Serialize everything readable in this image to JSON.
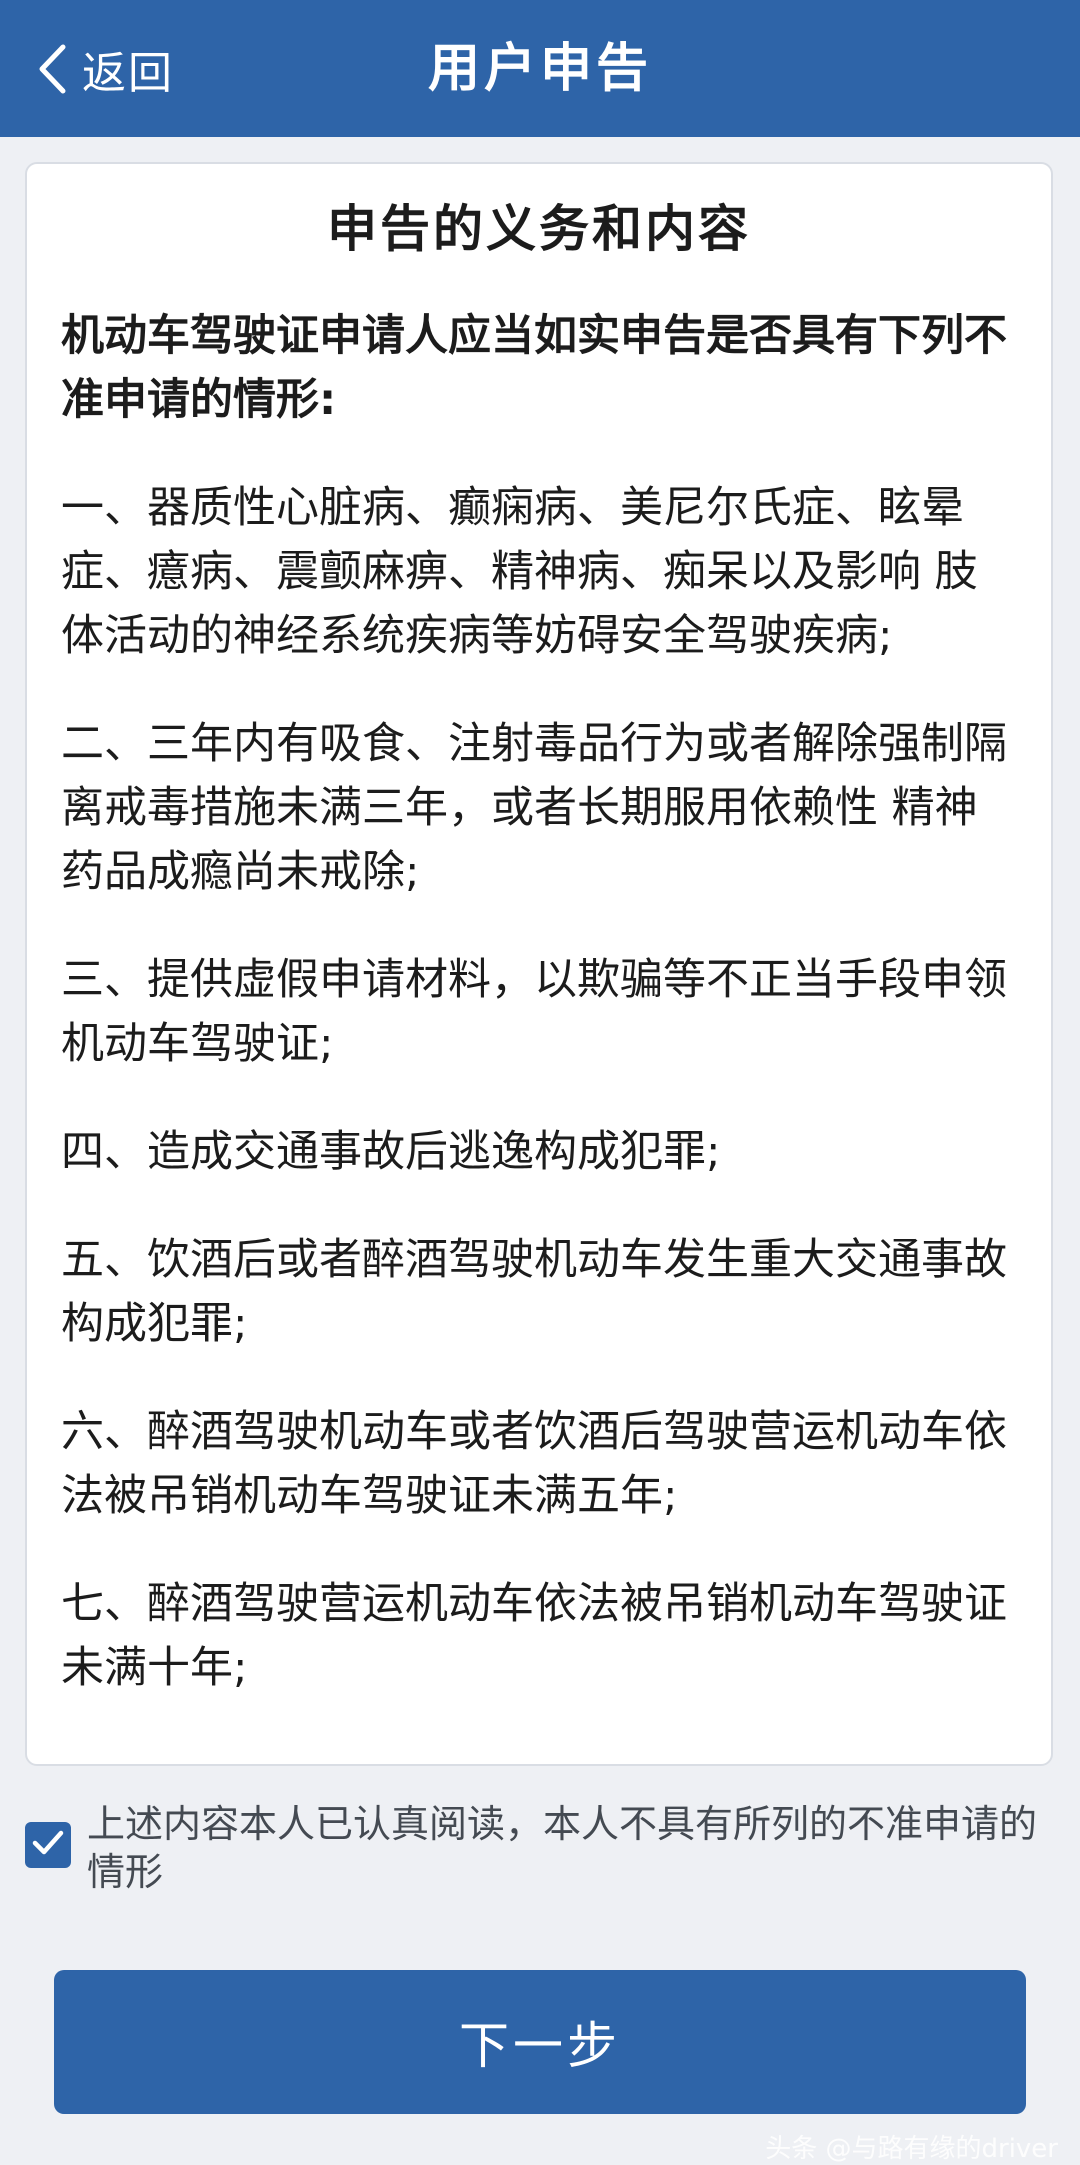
{
  "header": {
    "back_label": "返回",
    "title": "用户申告"
  },
  "card": {
    "title": "申告的义务和内容",
    "intro": "机动车驾驶证申请人应当如实申告是否具有下列不准申请的情形:",
    "clauses": [
      "一、器质性心脏病、癫痫病、美尼尔氏症、眩晕症、癔病、震颤麻痹、精神病、痴呆以及影响 肢体活动的神经系统疾病等妨碍安全驾驶疾病;",
      "二、三年内有吸食、注射毒品行为或者解除强制隔离戒毒措施未满三年，或者长期服用依赖性 精神药品成瘾尚未戒除;",
      "三、提供虚假申请材料，以欺骗等不正当手段申领机动车驾驶证;",
      "四、造成交通事故后逃逸构成犯罪;",
      "五、饮酒后或者醉酒驾驶机动车发生重大交通事故构成犯罪;",
      "六、醉酒驾驶机动车或者饮酒后驾驶营运机动车依法被吊销机动车驾驶证未满五年;",
      "七、醉酒驾驶营运机动车依法被吊销机动车驾驶证未满十年;"
    ]
  },
  "consent": {
    "checked": true,
    "text": "上述内容本人已认真阅读，本人不具有所列的不准申请的情形"
  },
  "footer": {
    "next_label": "下一步",
    "watermark": "头条 @与路有缘的driver"
  },
  "colors": {
    "primary": "#2e64a8",
    "background": "#eef0f4"
  }
}
